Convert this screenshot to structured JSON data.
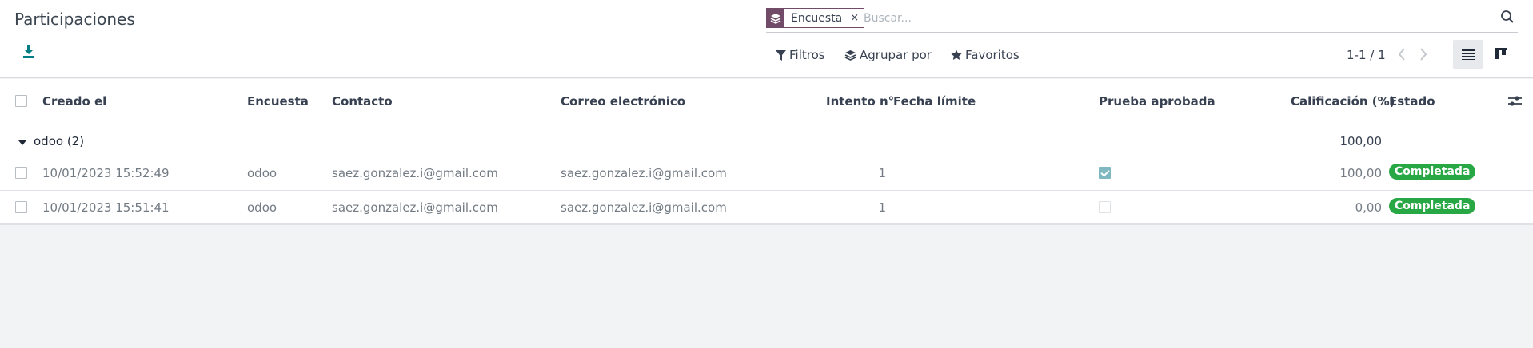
{
  "page": {
    "title": "Participaciones"
  },
  "search": {
    "facet_label": "Encuesta",
    "facet_remove": "×",
    "placeholder": "Buscar..."
  },
  "toolbar": {
    "filters": "Filtros",
    "group_by": "Agrupar por",
    "favorites": "Favoritos"
  },
  "pager": {
    "value": "1-1 / 1"
  },
  "list": {
    "columns": {
      "created": "Creado el",
      "survey": "Encuesta",
      "contact": "Contacto",
      "email": "Correo electrónico",
      "attempt": "Intento n°",
      "deadline": "Fecha límite",
      "passed": "Prueba aprobada",
      "score": "Calificación (%)",
      "state": "Estado"
    },
    "group": {
      "label": "odoo (2)",
      "score": "100,00"
    },
    "rows": [
      {
        "created": "10/01/2023 15:52:49",
        "survey": "odoo",
        "contact": "saez.gonzalez.i@gmail.com",
        "email": "saez.gonzalez.i@gmail.com",
        "attempt": "1",
        "deadline": "",
        "passed": true,
        "score": "100,00",
        "state": "Completada"
      },
      {
        "created": "10/01/2023 15:51:41",
        "survey": "odoo",
        "contact": "saez.gonzalez.i@gmail.com",
        "email": "saez.gonzalez.i@gmail.com",
        "attempt": "1",
        "deadline": "",
        "passed": false,
        "score": "0,00",
        "state": "Completada"
      }
    ]
  },
  "colors": {
    "brand": "#714b67",
    "success": "#28a745",
    "checked": "#7fb8c0",
    "background": "#f2f3f4"
  },
  "icons": [
    "download-icon",
    "layers-icon",
    "search-icon",
    "filter-icon",
    "favorite-star-icon",
    "chevron-left-icon",
    "chevron-right-icon",
    "list-view-icon",
    "kanban-view-icon",
    "caret-down-icon",
    "optional-columns-icon"
  ]
}
